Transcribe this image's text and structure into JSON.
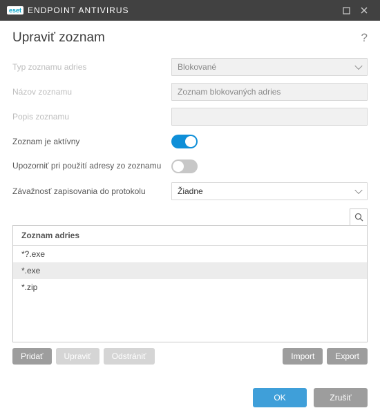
{
  "brand": "eset",
  "app_title": "ENDPOINT ANTIVIRUS",
  "page_title": "Upraviť zoznam",
  "help_symbol": "?",
  "fields": {
    "type_label": "Typ zoznamu adries",
    "type_value": "Blokované",
    "name_label": "Názov zoznamu",
    "name_value": "Zoznam blokovaných adries",
    "desc_label": "Popis zoznamu",
    "desc_value": "",
    "active_label": "Zoznam je aktívny",
    "notify_label": "Upozorniť pri použití adresy zo zoznamu",
    "severity_label": "Závažnosť zapisovania do protokolu",
    "severity_value": "Žiadne"
  },
  "toggles": {
    "active": true,
    "notify": false
  },
  "list": {
    "header": "Zoznam adries",
    "items": [
      "*?.exe",
      "*.exe",
      "*.zip"
    ],
    "selected_index": 1
  },
  "buttons": {
    "add": "Pridať",
    "edit": "Upraviť",
    "delete": "Odstrániť",
    "import": "Import",
    "export": "Export",
    "ok": "OK",
    "cancel": "Zrušiť"
  }
}
